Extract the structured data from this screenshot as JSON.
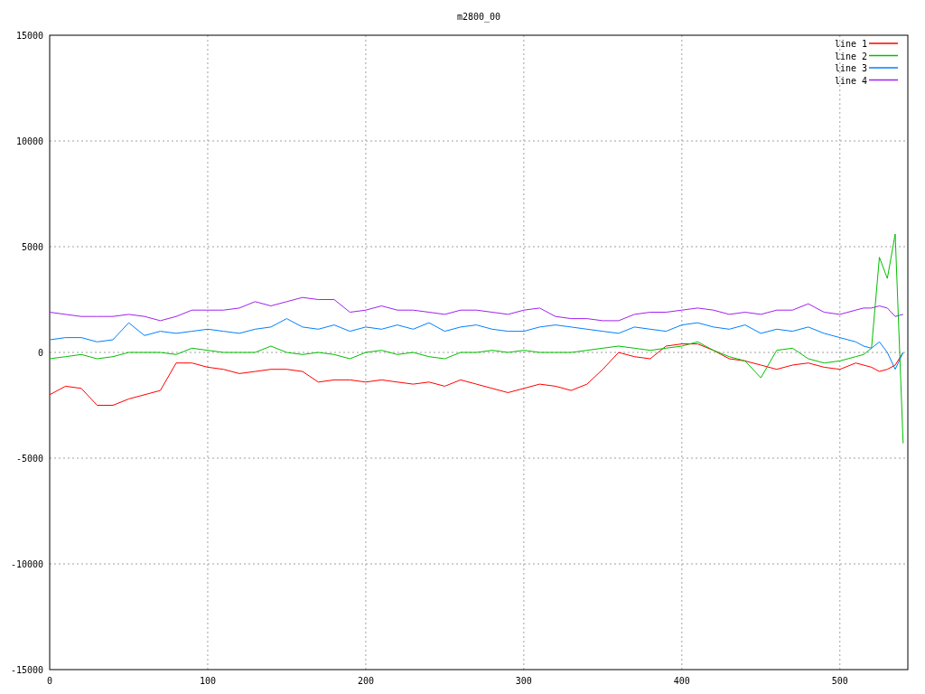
{
  "chart_data": {
    "type": "line",
    "title": "m2800_00",
    "x": [
      0,
      10,
      20,
      30,
      40,
      50,
      60,
      70,
      80,
      90,
      100,
      110,
      120,
      130,
      140,
      150,
      160,
      170,
      180,
      190,
      200,
      210,
      220,
      230,
      240,
      250,
      260,
      270,
      280,
      290,
      300,
      310,
      320,
      330,
      340,
      350,
      360,
      370,
      380,
      390,
      400,
      410,
      420,
      430,
      440,
      450,
      460,
      470,
      480,
      490,
      500,
      510,
      515,
      520,
      525,
      530,
      535,
      540
    ],
    "series": [
      {
        "name": "line 1",
        "color": "#ff0000",
        "values": [
          -2000,
          -1600,
          -1700,
          -2500,
          -2500,
          -2200,
          -2000,
          -1800,
          -500,
          -500,
          -700,
          -800,
          -1000,
          -900,
          -800,
          -800,
          -900,
          -1400,
          -1300,
          -1300,
          -1400,
          -1300,
          -1400,
          -1500,
          -1400,
          -1600,
          -1300,
          -1500,
          -1700,
          -1900,
          -1700,
          -1500,
          -1600,
          -1800,
          -1500,
          -800,
          0,
          -200,
          -300,
          300,
          400,
          400,
          100,
          -300,
          -400,
          -600,
          -800,
          -600,
          -500,
          -700,
          -800,
          -500,
          -600,
          -700,
          -900,
          -800,
          -600,
          0
        ]
      },
      {
        "name": "line 2",
        "color": "#00c000",
        "values": [
          -300,
          -200,
          -100,
          -300,
          -200,
          0,
          0,
          0,
          -100,
          200,
          100,
          0,
          0,
          0,
          300,
          0,
          -100,
          0,
          -100,
          -300,
          0,
          100,
          -100,
          0,
          -200,
          -300,
          0,
          0,
          100,
          0,
          100,
          0,
          0,
          0,
          100,
          200,
          300,
          200,
          100,
          200,
          300,
          500,
          100,
          -200,
          -400,
          -1200,
          100,
          200,
          -300,
          -500,
          -400,
          -200,
          -100,
          200,
          4500,
          3500,
          5600,
          -4300
        ]
      },
      {
        "name": "line 3",
        "color": "#0080ff",
        "values": [
          600,
          700,
          700,
          500,
          600,
          1400,
          800,
          1000,
          900,
          1000,
          1100,
          1000,
          900,
          1100,
          1200,
          1600,
          1200,
          1100,
          1300,
          1000,
          1200,
          1100,
          1300,
          1100,
          1400,
          1000,
          1200,
          1300,
          1100,
          1000,
          1000,
          1200,
          1300,
          1200,
          1100,
          1000,
          900,
          1200,
          1100,
          1000,
          1300,
          1400,
          1200,
          1100,
          1300,
          900,
          1100,
          1000,
          1200,
          900,
          700,
          500,
          300,
          200,
          500,
          0,
          -800,
          0
        ]
      },
      {
        "name": "line 4",
        "color": "#a020f0",
        "values": [
          1900,
          1800,
          1700,
          1700,
          1700,
          1800,
          1700,
          1500,
          1700,
          2000,
          2000,
          2000,
          2100,
          2400,
          2200,
          2400,
          2600,
          2500,
          2500,
          1900,
          2000,
          2200,
          2000,
          2000,
          1900,
          1800,
          2000,
          2000,
          1900,
          1800,
          2000,
          2100,
          1700,
          1600,
          1600,
          1500,
          1500,
          1800,
          1900,
          1900,
          2000,
          2100,
          2000,
          1800,
          1900,
          1800,
          2000,
          2000,
          2300,
          1900,
          1800,
          2000,
          2100,
          2100,
          2200,
          2100,
          1700,
          1800
        ]
      }
    ],
    "grid": true,
    "legend": true,
    "xlim": [
      0,
      543
    ],
    "ylim": [
      -15000,
      15000
    ],
    "xticks": [
      0,
      100,
      200,
      300,
      400,
      500
    ],
    "yticks": [
      -15000,
      -10000,
      -5000,
      0,
      5000,
      10000,
      15000
    ]
  }
}
